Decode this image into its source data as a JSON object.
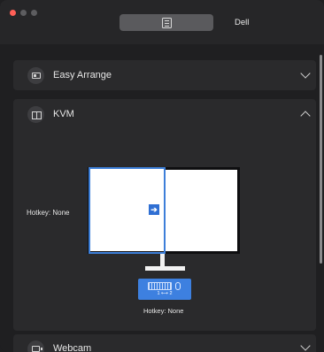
{
  "window": {
    "title": "Dell",
    "toolbar_icon": "document-list-icon"
  },
  "sections": [
    {
      "label": "Easy Arrange",
      "icon": "easy-arrange-icon",
      "state": "collapsed"
    },
    {
      "label": "KVM",
      "icon": "kvm-icon",
      "state": "expanded"
    },
    {
      "label": "Webcam",
      "icon": "webcam-icon",
      "state": "collapsed"
    }
  ],
  "kvm": {
    "hotkey_left": "Hotkey: None",
    "hotkey_bottom": "Hotkey: None",
    "switch_arrow": "➔",
    "switch_label": "1 ⟷ 2"
  },
  "colors": {
    "accent": "#3d7fd9",
    "close": "#ff5f57",
    "panel": "#2a2a2c",
    "background": "#1f1f21"
  }
}
